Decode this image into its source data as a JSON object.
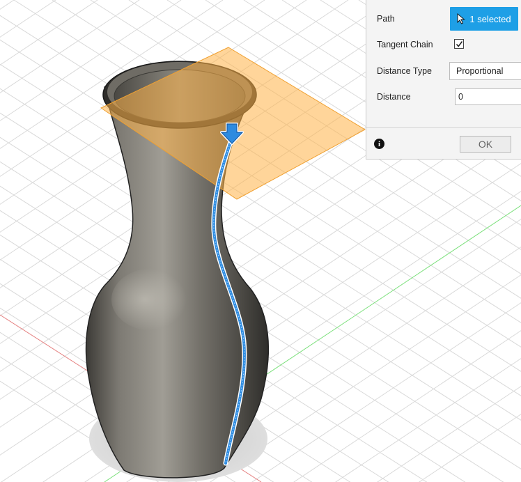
{
  "panel": {
    "path": {
      "label": "Path",
      "button_text": "1 selected",
      "icon": "cursor-arrow-icon"
    },
    "tangent_chain": {
      "label": "Tangent Chain",
      "checked": true
    },
    "distance_type": {
      "label": "Distance Type",
      "value": "Proportional"
    },
    "distance": {
      "label": "Distance",
      "value": "0"
    },
    "info_icon": "i",
    "ok_label": "OK"
  },
  "colors": {
    "accent": "#1e9fe6",
    "plane_fill": "#ffb347",
    "vase_body": "#6e6b64",
    "path_curve": "#2d8be0",
    "x_axis": "#e06464",
    "y_axis": "#5cd65c"
  }
}
